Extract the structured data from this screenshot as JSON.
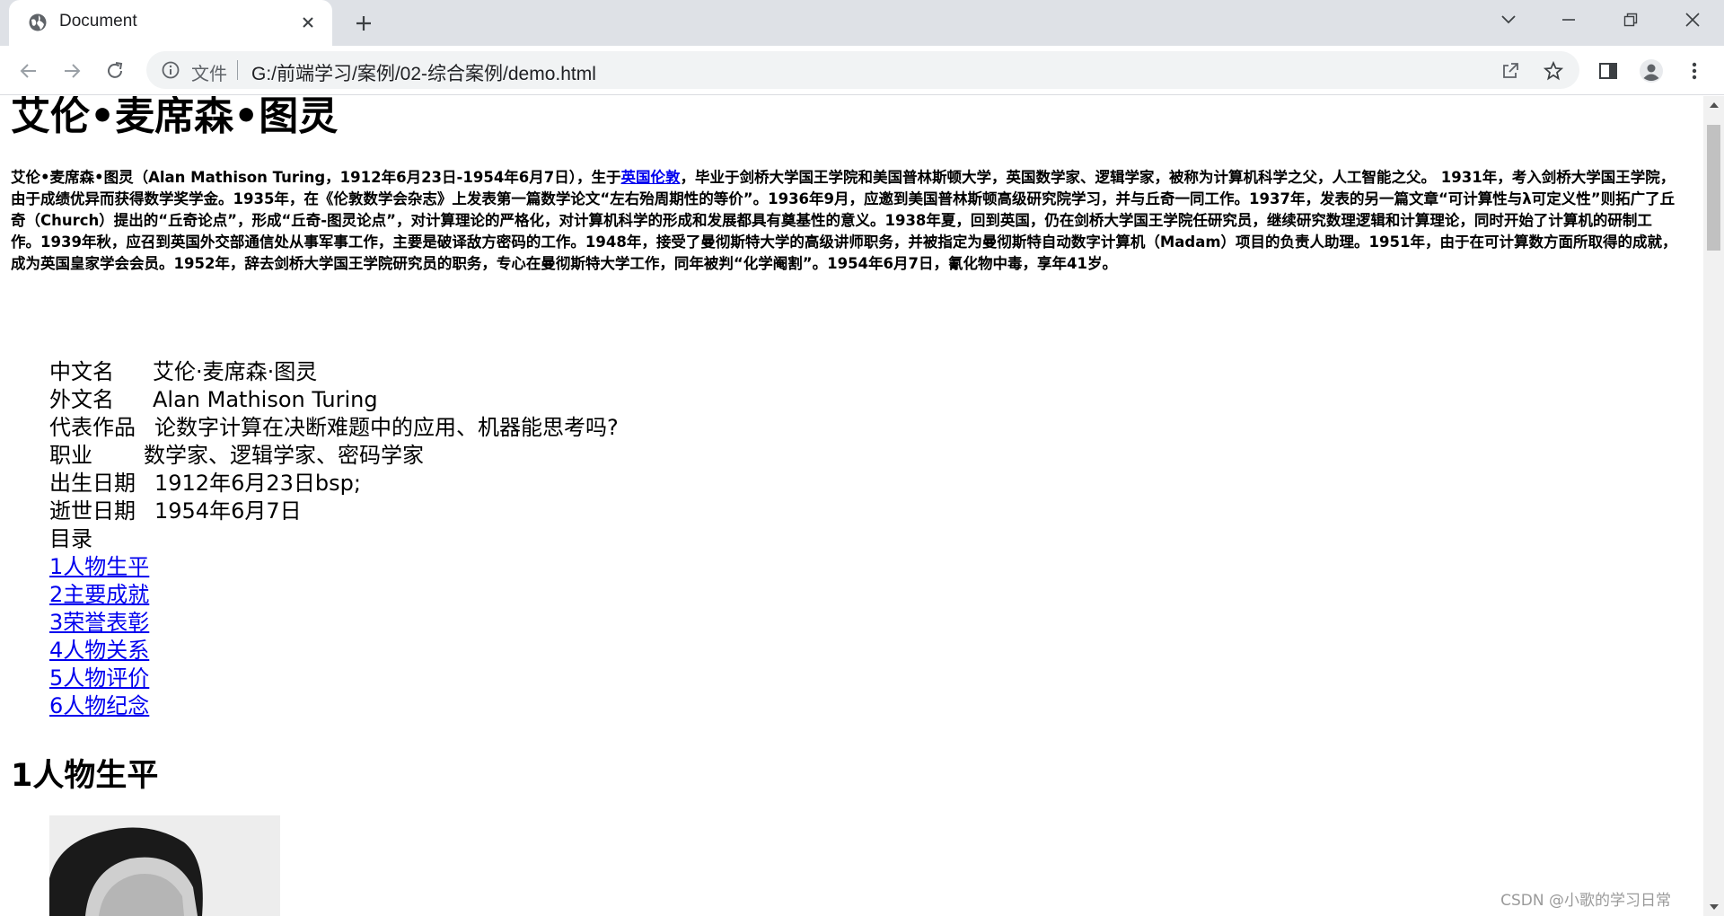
{
  "browser": {
    "tab_title": "Document",
    "address": {
      "file_label": "文件",
      "url": "G:/前端学习/案例/02-综合案例/demo.html"
    }
  },
  "page": {
    "h1": "艾伦•麦席森•图灵",
    "intro_before_link": "艾伦•麦席森•图灵（Alan Mathison Turing，1912年6月23日-1954年6月7日），生于",
    "intro_link": "英国伦敦",
    "intro_after_link": "，毕业于剑桥大学国王学院和美国普林斯顿大学，英国数学家、逻辑学家，被称为计算机科学之父，人工智能之父。 1931年，考入剑桥大学国王学院，由于成绩优异而获得数学奖学金。1935年，在《伦敦数学会杂志》上发表第一篇数学论文“左右殆周期性的等价”。1936年9月，应邀到美国普林斯顿高级研究院学习，并与丘奇一同工作。1937年，发表的另一篇文章“可计算性与λ可定义性”则拓广了丘奇（Church）提出的“丘奇论点”，形成“丘奇-图灵论点”，对计算理论的严格化，对计算机科学的形成和发展都具有奠基性的意义。1938年夏，回到英国，仍在剑桥大学国王学院任研究员，继续研究数理逻辑和计算理论，同时开始了计算机的研制工作。1939年秋，应召到英国外交部通信处从事军事工作，主要是破译敌方密码的工作。1948年，接受了曼彻斯特大学的高级讲师职务，并被指定为曼彻斯特自动数字计算机（Madam）项目的负责人助理。1951年，由于在可计算数方面所取得的成就，成为英国皇家学会会员。1952年，辞去剑桥大学国王学院研究员的职务，专心在曼彻斯特大学工作，同年被判“化学阉割”。1954年6月7日，氰化物中毒，享年41岁。",
    "info": [
      {
        "label": "中文名",
        "value": "艾伦·麦席森·图灵"
      },
      {
        "label": "外文名",
        "value": "Alan Mathison Turing"
      },
      {
        "label": "代表作品",
        "value": "论数字计算在决断难题中的应用、机器能思考吗?"
      },
      {
        "label": "职业",
        "value": "数学家、逻辑学家、密码学家"
      },
      {
        "label": "出生日期",
        "value": "1912年6月23日bsp;"
      },
      {
        "label": "逝世日期",
        "value": "1954年6月7日"
      }
    ],
    "toc_title": "目录",
    "toc": [
      "1人物生平",
      "2主要成就",
      "3荣誉表彰",
      "4人物关系",
      "5人物评价",
      "6人物纪念"
    ],
    "h2": "1人物生平",
    "watermark": "CSDN @小歌的学习日常"
  }
}
